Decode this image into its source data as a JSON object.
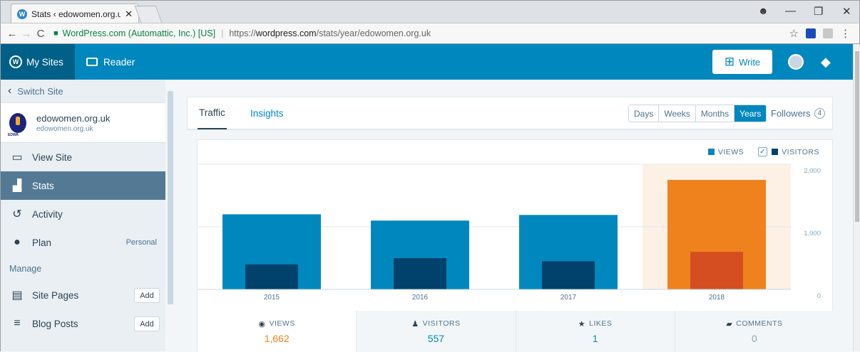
{
  "browser": {
    "tab_title": "Stats ‹ edowomen.org.uk",
    "tab_close": "✕",
    "back": "←",
    "forward": "→",
    "reload": "C",
    "security_label": "WordPress.com (Automattic, Inc.) [US]",
    "url_scheme": "https://",
    "url_domain": "wordpress.com",
    "url_path": "/stats/year/edowomen.org.uk",
    "star": "☆",
    "menu": "⋮",
    "minimize": "—",
    "maximize": "❐",
    "close": "✕"
  },
  "masterbar": {
    "my_sites": "My Sites",
    "reader": "Reader",
    "write": "Write"
  },
  "sidebar": {
    "switch_site": "Switch Site",
    "site_name": "edowomen.org.uk",
    "site_url": "edowomen.org.uk",
    "site_logo_text": "EDWA",
    "items": [
      {
        "label": "View Site"
      },
      {
        "label": "Stats"
      },
      {
        "label": "Activity"
      },
      {
        "label": "Plan",
        "extra": "Personal"
      }
    ],
    "manage_heading": "Manage",
    "manage_items": [
      {
        "label": "Site Pages",
        "button": "Add"
      },
      {
        "label": "Blog Posts",
        "button": "Add"
      }
    ]
  },
  "stats_nav": {
    "tabs": [
      {
        "label": "Traffic"
      },
      {
        "label": "Insights"
      }
    ],
    "periods": [
      "Days",
      "Weeks",
      "Months",
      "Years"
    ],
    "selected_period": "Years",
    "followers_label": "Followers",
    "followers_count": "4"
  },
  "legend": {
    "views": "VIEWS",
    "visitors": "VISITORS"
  },
  "chart_data": {
    "type": "bar",
    "categories": [
      "2015",
      "2016",
      "2017",
      "2018"
    ],
    "series": [
      {
        "name": "VIEWS",
        "values": [
          1200,
          1100,
          1190,
          1750
        ]
      },
      {
        "name": "VISITORS",
        "values": [
          400,
          500,
          450,
          600
        ]
      }
    ],
    "y_ticks": [
      "2,000",
      "1,000",
      "0"
    ],
    "ylim": [
      0,
      2000
    ],
    "highlight_category": "2018",
    "colors": {
      "views": "#0087be",
      "visitors": "#00426b",
      "views_selected": "#f0821e",
      "visitors_selected": "#d54e21",
      "highlight_bg": "#fdf1e6"
    }
  },
  "summary": {
    "tabs": [
      {
        "label": "VIEWS",
        "value": "1,662",
        "icon": "eye-icon"
      },
      {
        "label": "VISITORS",
        "value": "557",
        "icon": "person-icon"
      },
      {
        "label": "LIKES",
        "value": "1",
        "icon": "star-icon"
      },
      {
        "label": "COMMENTS",
        "value": "0",
        "icon": "comment-icon"
      }
    ]
  }
}
